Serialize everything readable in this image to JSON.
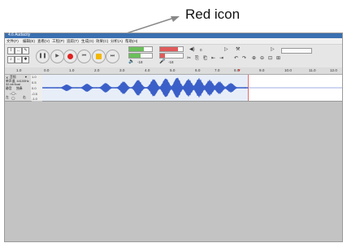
{
  "annotation": {
    "label": "Red icon",
    "line_color": "#888888"
  },
  "window": {
    "title": "4.6 Audacity"
  },
  "menu": [
    "文件(F)",
    "编辑(E)",
    "查看(V)",
    "工程(P)",
    "追踪(T)",
    "生成(G)",
    "效果(C)",
    "分析(A)",
    "帮助(H)"
  ],
  "toolbar": {
    "transport_icons": [
      "pause-icon",
      "play-icon",
      "stop-icon",
      "skip-start-icon",
      "skip-end-icon",
      "record-icon"
    ],
    "meter_label_left": "-18",
    "meter_label_right": "-18",
    "volume_label": "0",
    "record_color": "#e02020",
    "pause_color": "#f2b700"
  },
  "ruler": {
    "ticks": [
      "1.0",
      "0.0",
      "1.0",
      "2.0",
      "3.0",
      "4.0",
      "5.0",
      "6.0",
      "7.0",
      "8.0",
      "9.0",
      "10.0",
      "11.0",
      "12.0"
    ]
  },
  "track": {
    "name": "音频",
    "info1": "单声道, 44100Hz",
    "info2": "32-bit float",
    "btn_mute": "静音",
    "btn_solo": "独奏",
    "left_right": "左",
    "right_label": "右",
    "scale": [
      "1.0",
      "0.5",
      "0.0",
      "-0.5",
      "-1.0"
    ],
    "wave_color": "#3b5fc8",
    "selected_bg": "#e7eef8"
  }
}
